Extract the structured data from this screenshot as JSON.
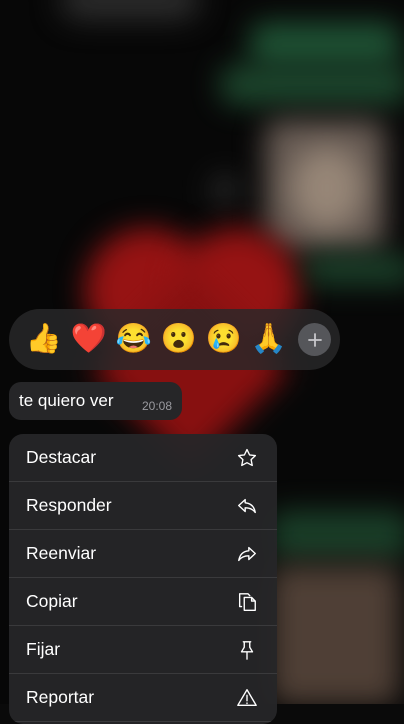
{
  "reactions": {
    "emojis": [
      {
        "name": "thumbs-up",
        "glyph": "👍"
      },
      {
        "name": "red-heart",
        "glyph": "❤️"
      },
      {
        "name": "tears-of-joy",
        "glyph": "😂"
      },
      {
        "name": "surprised",
        "glyph": "😮"
      },
      {
        "name": "crying",
        "glyph": "😢"
      },
      {
        "name": "folded-hands",
        "glyph": "🙏"
      }
    ],
    "add_icon": "plus-icon"
  },
  "message": {
    "text": "te quiero ver",
    "time": "20:08"
  },
  "menu": {
    "items": [
      {
        "label": "Destacar",
        "icon": "star-icon"
      },
      {
        "label": "Responder",
        "icon": "reply-icon"
      },
      {
        "label": "Reenviar",
        "icon": "forward-icon"
      },
      {
        "label": "Copiar",
        "icon": "copy-icon"
      },
      {
        "label": "Fijar",
        "icon": "pin-icon"
      },
      {
        "label": "Reportar",
        "icon": "warning-icon"
      }
    ]
  },
  "colors": {
    "background": "#0a0a0a",
    "panel": "#262628",
    "heart_blur": "#c81a1a",
    "green_blur": "#2b6b44"
  }
}
